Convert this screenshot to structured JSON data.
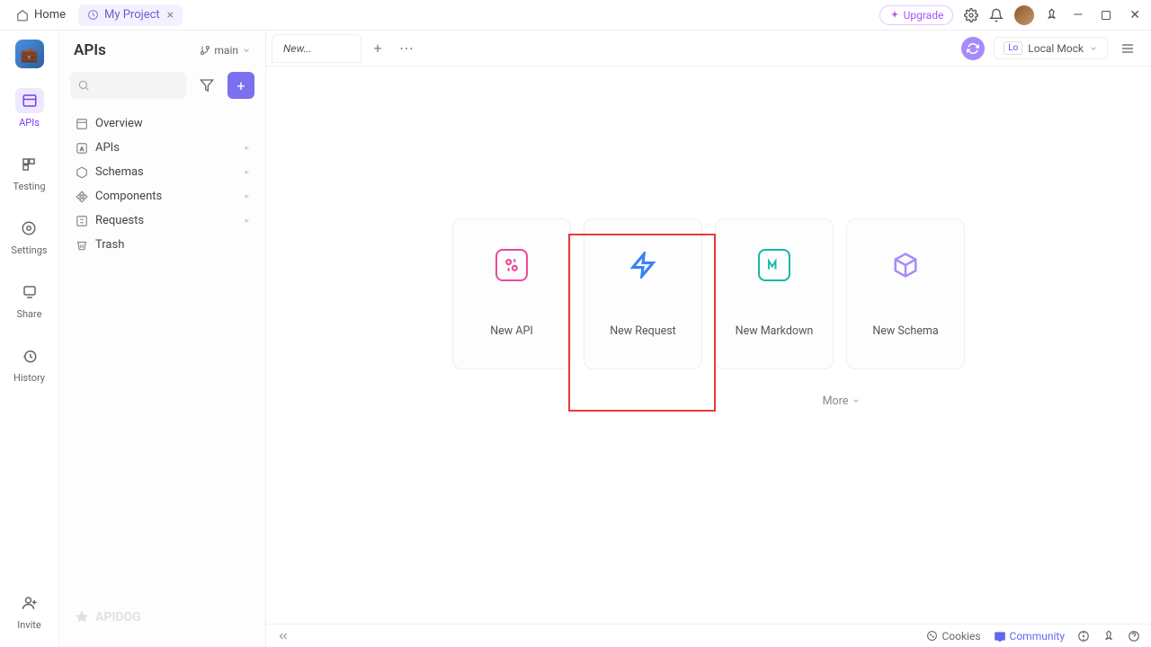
{
  "titlebar": {
    "home": "Home",
    "project": "My Project",
    "upgrade": "Upgrade"
  },
  "rail": {
    "apis": "APIs",
    "testing": "Testing",
    "settings": "Settings",
    "share": "Share",
    "history": "History",
    "invite": "Invite"
  },
  "sidebar": {
    "title": "APIs",
    "branch": "main",
    "items": {
      "overview": "Overview",
      "apis": "APIs",
      "schemas": "Schemas",
      "components": "Components",
      "requests": "Requests",
      "trash": "Trash"
    },
    "watermark": "APIDOG"
  },
  "tabs": {
    "new": "New...",
    "env": "Local Mock",
    "env_badge": "Lo"
  },
  "cards": {
    "api": "New API",
    "request": "New Request",
    "markdown": "New Markdown",
    "schema": "New Schema",
    "more": "More"
  },
  "bottom": {
    "cookies": "Cookies",
    "community": "Community"
  }
}
